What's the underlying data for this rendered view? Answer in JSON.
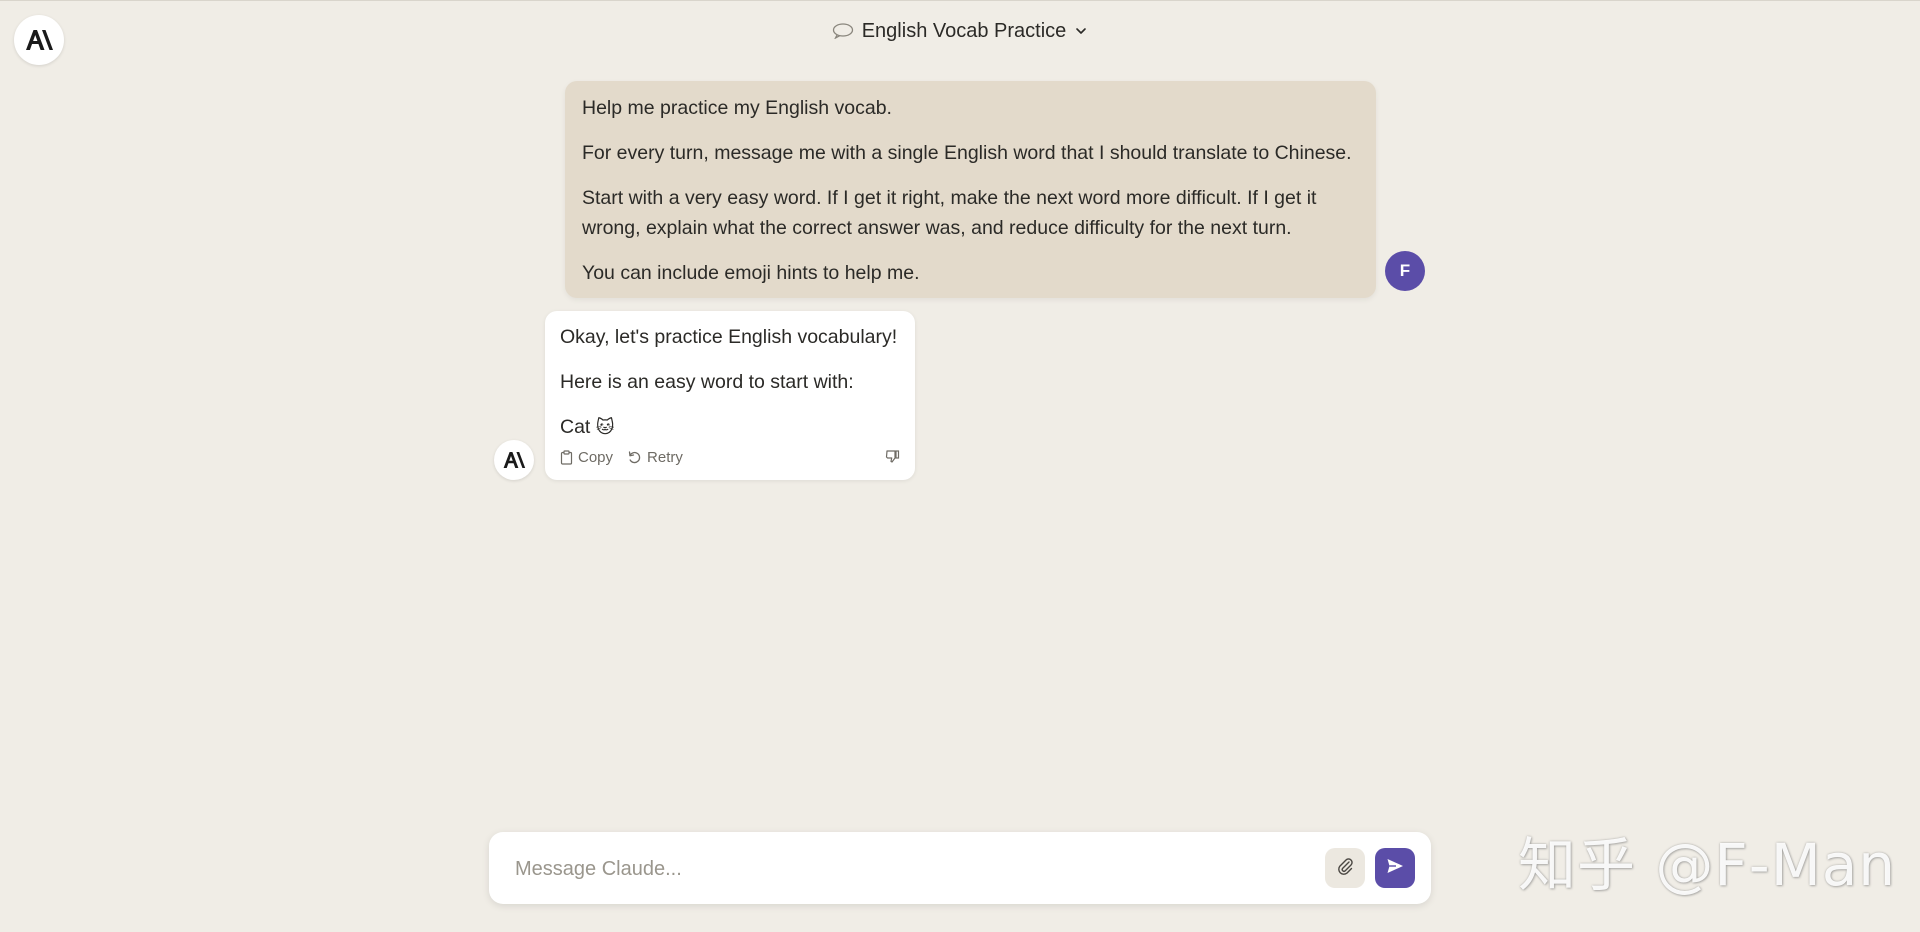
{
  "header": {
    "title": "English Vocab Practice",
    "title_icon": "chat-bubble-icon",
    "dropdown_icon": "chevron-down-icon"
  },
  "app": {
    "logo_icon": "anthropic-logo-icon"
  },
  "user_message": {
    "avatar_initial": "F",
    "paragraphs": [
      "Help me practice my English vocab.",
      "For every turn, message me with a single English word that I should translate to Chinese.",
      "Start with a very easy word. If I get it right, make the next word more difficult. If I get it wrong, explain what the correct answer was, and reduce difficulty for the next turn.",
      "You can include emoji hints to help me."
    ]
  },
  "assistant_message": {
    "paragraphs": [
      "Okay, let's practice English vocabulary!",
      "Here is an easy word to start with:"
    ],
    "word": "Cat",
    "emoji": "🐱",
    "actions": {
      "copy_label": "Copy",
      "retry_label": "Retry"
    }
  },
  "composer": {
    "placeholder": "Message Claude...",
    "value": ""
  },
  "watermark": {
    "text": "知乎 @F-Man"
  },
  "colors": {
    "background": "#f0ede6",
    "user_bubble": "#e3dacb",
    "accent": "#5b4da8"
  }
}
